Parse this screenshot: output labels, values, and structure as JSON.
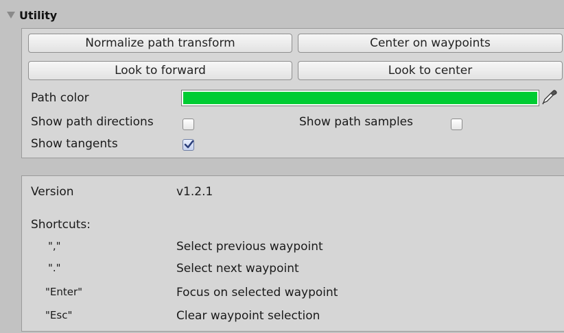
{
  "foldout": {
    "title": "Utility",
    "expanded": true
  },
  "buttons": {
    "normalize": "Normalize path transform",
    "center_on_waypoints": "Center on waypoints",
    "look_forward": "Look to forward",
    "look_center": "Look to center"
  },
  "path_color": {
    "label": "Path color",
    "value": "#00cc33",
    "picker_icon": "eyedropper-icon"
  },
  "toggles": {
    "show_path_directions": {
      "label": "Show path directions",
      "checked": false
    },
    "show_path_samples": {
      "label": "Show path samples",
      "checked": false
    },
    "show_tangents": {
      "label": "Show tangents",
      "checked": true
    }
  },
  "info": {
    "version_label": "Version",
    "version_value": "v1.2.1",
    "shortcuts_label": "Shortcuts:",
    "shortcuts": [
      {
        "key": "\",\"",
        "action": "Select previous waypoint"
      },
      {
        "key": "\".\"",
        "action": "Select next waypoint"
      },
      {
        "key": "\"Enter\"",
        "action": "Focus on selected waypoint"
      },
      {
        "key": "\"Esc\"",
        "action": "Clear waypoint selection"
      }
    ]
  },
  "colors": {
    "panel_bg": "#d6d6d6",
    "background": "#c2c2c2",
    "path_color": "#00cc33"
  }
}
